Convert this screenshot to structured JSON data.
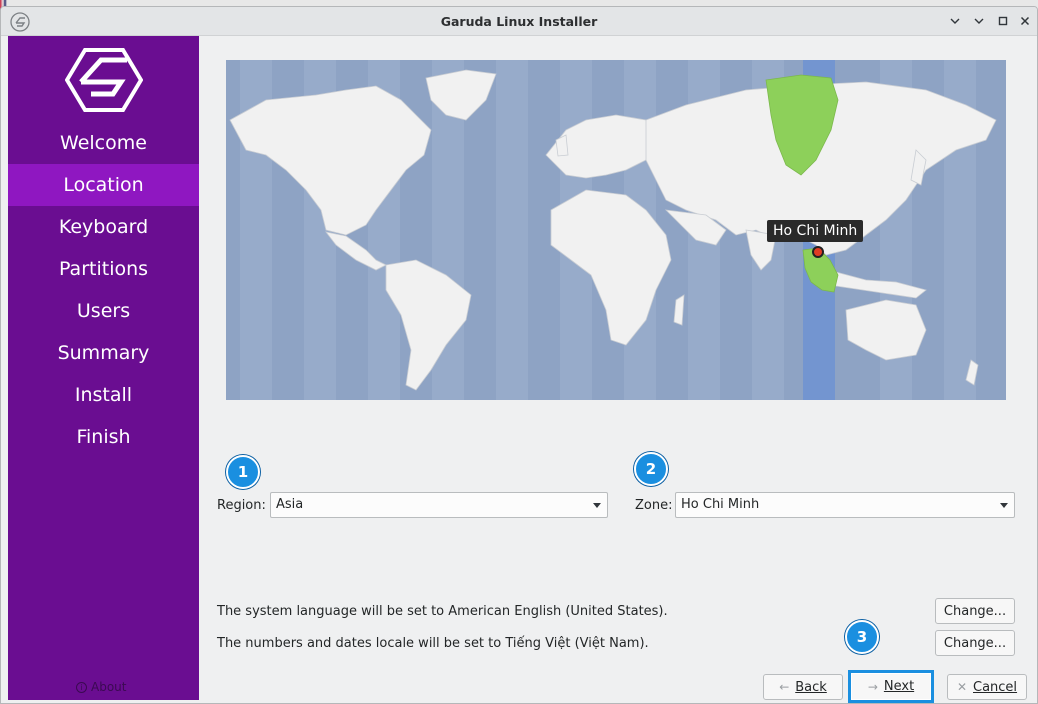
{
  "window": {
    "title": "Garuda Linux Installer",
    "app_icon": "garuda-logo-icon",
    "controls": [
      "chevron-down-icon",
      "minimize-icon",
      "maximize-icon",
      "close-icon"
    ]
  },
  "sidebar": {
    "logo": "garuda-logo-icon",
    "items": [
      {
        "label": "Welcome"
      },
      {
        "label": "Location",
        "active": true
      },
      {
        "label": "Keyboard"
      },
      {
        "label": "Partitions"
      },
      {
        "label": "Users"
      },
      {
        "label": "Summary"
      },
      {
        "label": "Install"
      },
      {
        "label": "Finish"
      }
    ],
    "about_label": "About"
  },
  "map": {
    "selected_city": "Ho Chi Minh"
  },
  "badges": [
    "1",
    "2",
    "3"
  ],
  "region": {
    "label": "Region:",
    "value": "Asia"
  },
  "zone": {
    "label": "Zone:",
    "value": "Ho Chi Minh"
  },
  "locale": {
    "language_text": "The system language will be set to American English (United States).",
    "numbers_text": "The numbers and dates locale will be set to Tiếng Việt (Việt Nam).",
    "change_label": "Change..."
  },
  "footer": {
    "back_label": "Back",
    "next_label": "Next",
    "cancel_label": "Cancel"
  },
  "colors": {
    "sidebar": "#6a0d91",
    "sidebar_active": "#8f17c1",
    "map_ocean": "#8ea3c4",
    "map_land": "#f1f1f1",
    "highlight_zone": "#7b9ad0",
    "highlight_land": "#8dd05a",
    "badge": "#1a8fe0"
  }
}
